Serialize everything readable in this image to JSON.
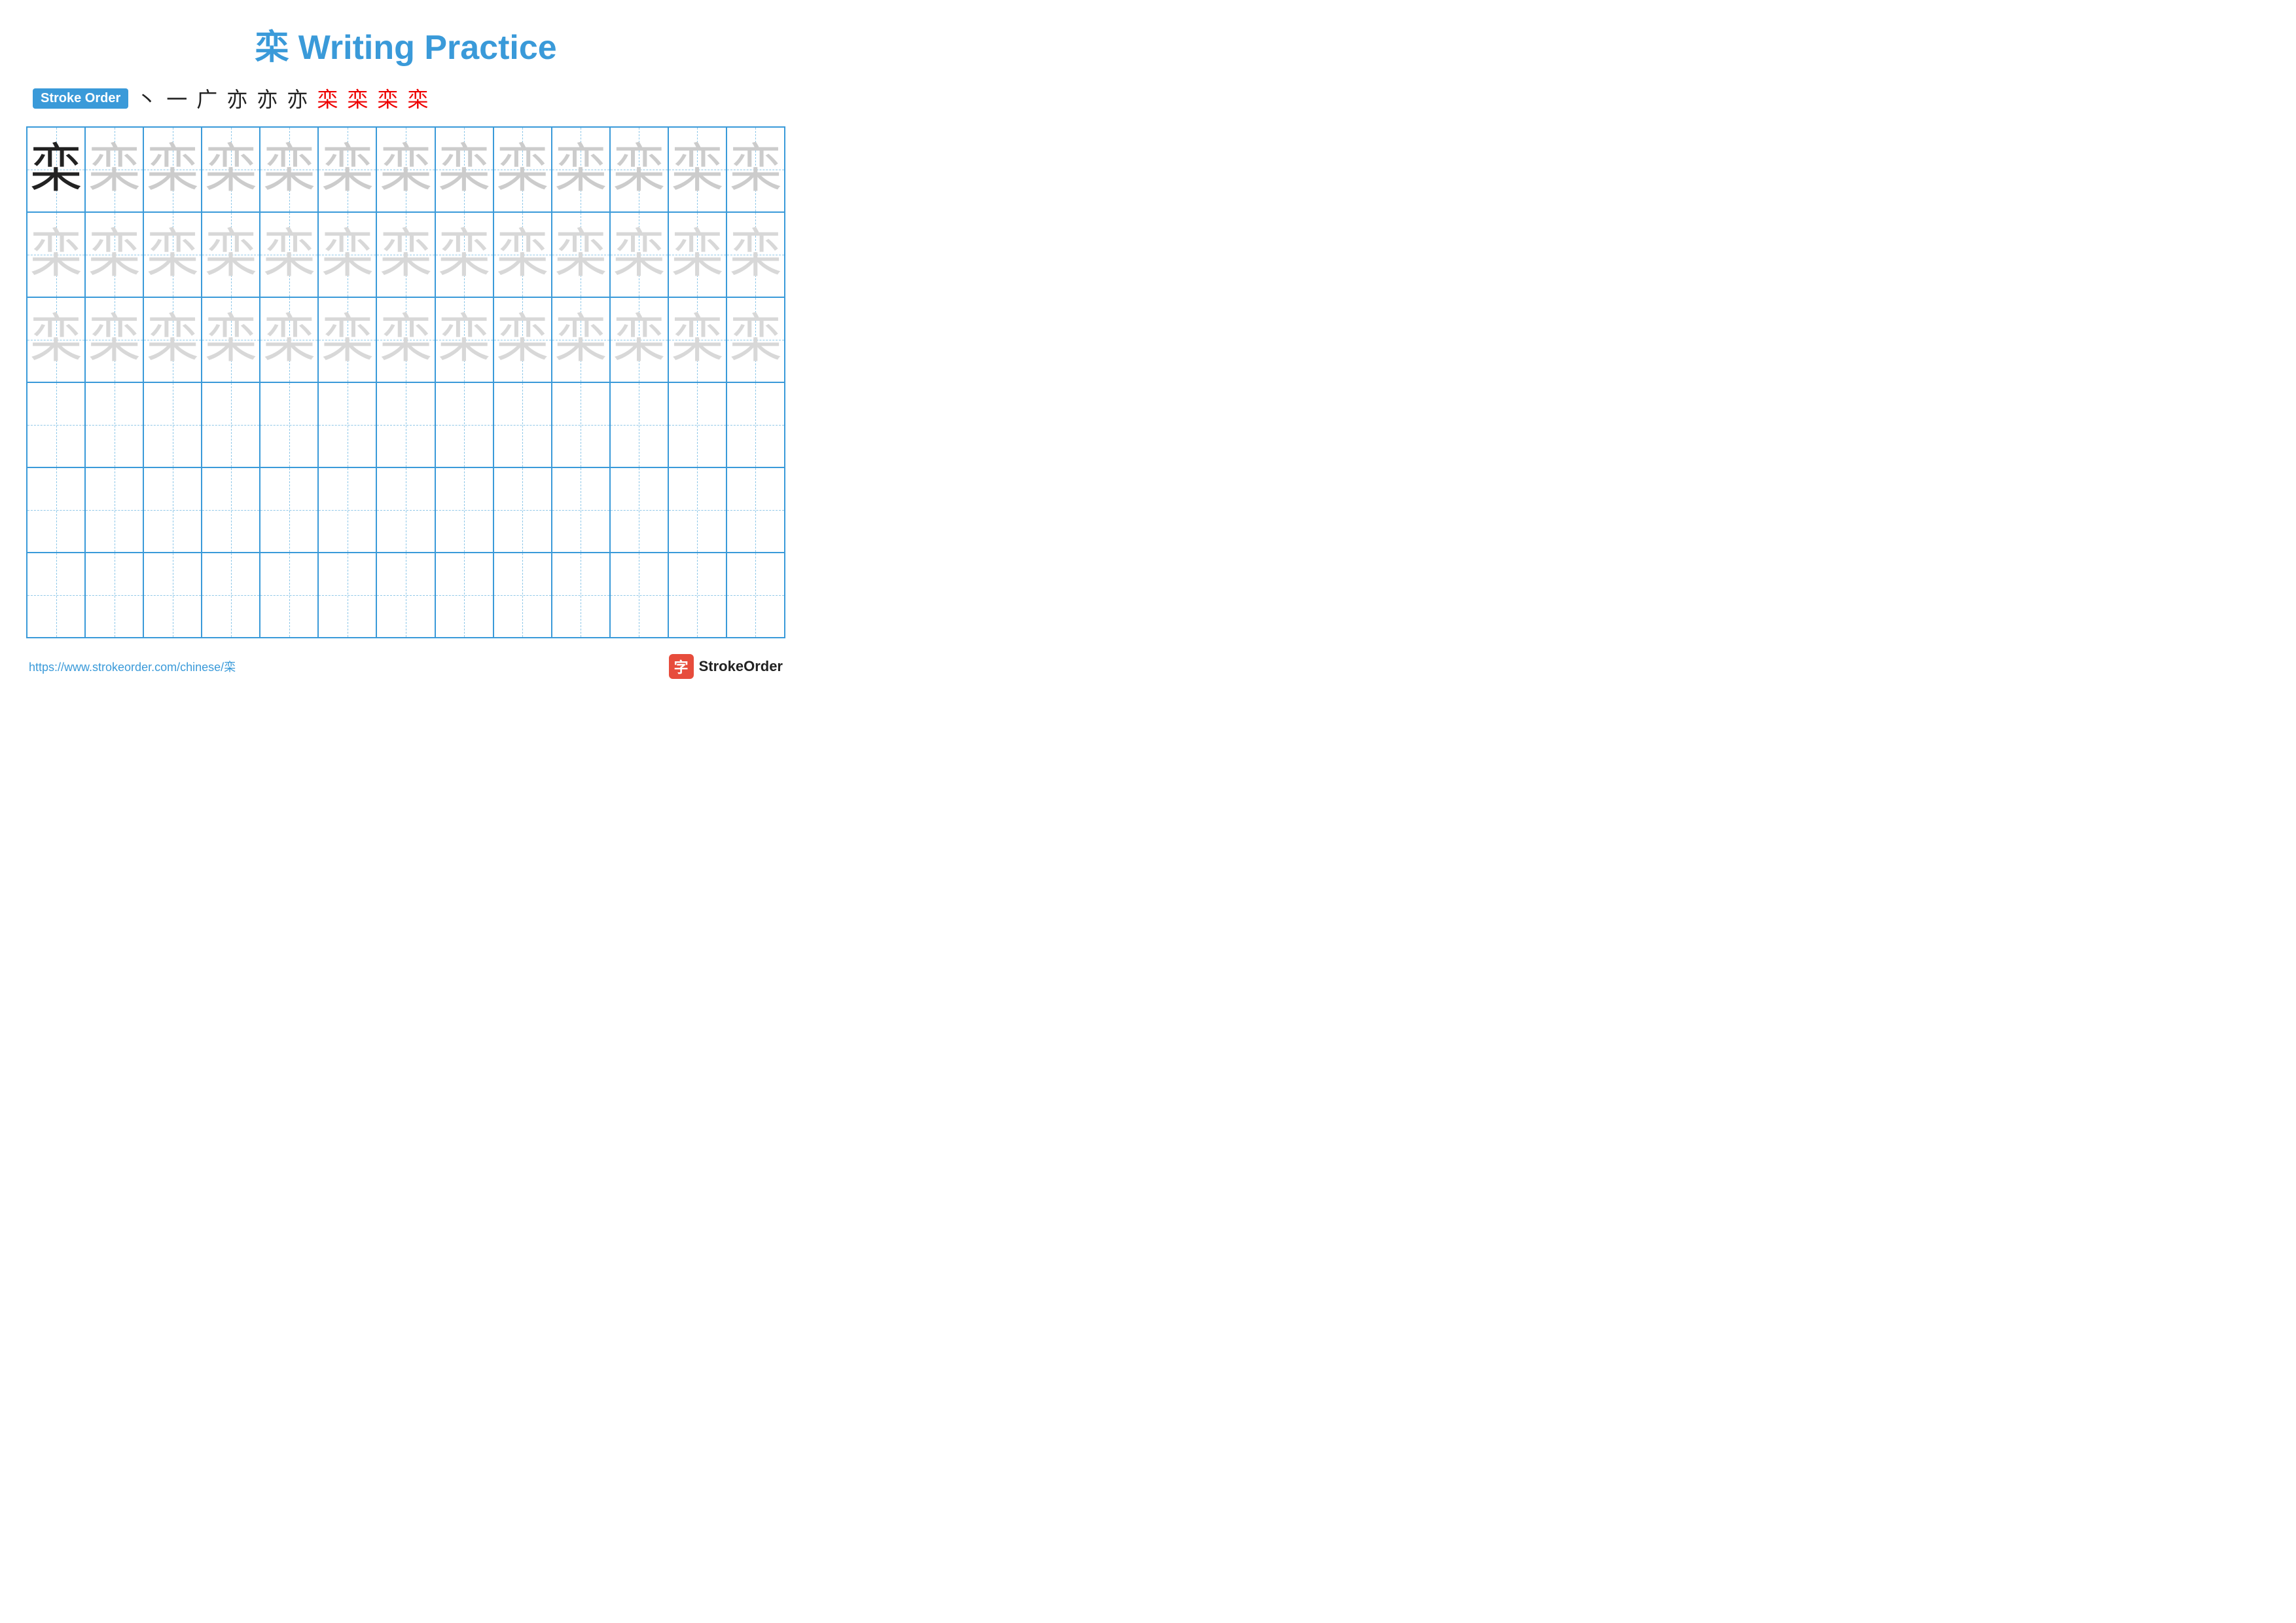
{
  "title": {
    "character": "栾",
    "text": " Writing Practice",
    "full": "栾 Writing Practice"
  },
  "stroke_order": {
    "badge": "Stroke Order",
    "strokes": [
      "丶",
      "一",
      "广",
      "亦",
      "亦",
      "亦",
      "栾",
      "栾",
      "栾",
      "栾"
    ],
    "red_from": 7
  },
  "grid": {
    "cols": 13,
    "rows": 6,
    "char": "栾",
    "guide_rows": 3,
    "empty_rows": 3
  },
  "footer": {
    "url": "https://www.strokeorder.com/chinese/栾",
    "brand_char": "字",
    "brand_name": "StrokeOrder"
  }
}
